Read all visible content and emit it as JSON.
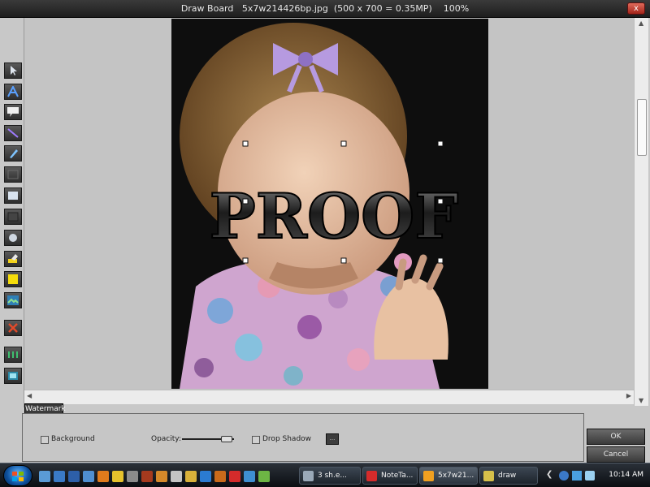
{
  "window": {
    "title": "Draw Board   5x7w214426bp.jpg  (500 x 700 = 0.35MP)    100%",
    "close_label": "x"
  },
  "toolbar": {
    "tools": [
      {
        "icon": "pointer-icon"
      },
      {
        "icon": "a-text-icon"
      },
      {
        "icon": "speech-balloon-icon"
      },
      {
        "icon": "line-icon"
      },
      {
        "icon": "pencil-icon"
      },
      {
        "icon": "rectangle-outline-icon"
      },
      {
        "icon": "rectangle-filled-icon"
      },
      {
        "icon": "dark-rectangle-icon"
      },
      {
        "icon": "ellipse-icon"
      },
      {
        "icon": "highlighter-icon"
      },
      {
        "icon": "yellow-square-icon"
      },
      {
        "icon": "image-icon"
      },
      {
        "icon": "delete-x-icon"
      },
      {
        "icon": "grid-icon"
      },
      {
        "icon": "layer-icon"
      }
    ]
  },
  "watermark": {
    "text": "PROOF",
    "tab_label": "Watermark",
    "background_label": "Background",
    "opacity_label": "Opacity:",
    "drop_shadow_label": "Drop Shadow",
    "more_button": "...",
    "background_checked": false,
    "drop_shadow_checked": false
  },
  "buttons": {
    "ok": "OK",
    "cancel": "Cancel"
  },
  "taskbar": {
    "tasks": [
      {
        "label": "3 sh.e...",
        "color": "#9aa9b8"
      },
      {
        "label": "NoteTa...",
        "color": "#d62b2b"
      },
      {
        "label": "5x7w21...",
        "color": "#f0a020"
      },
      {
        "label": "draw",
        "color": "#d6c04a"
      }
    ],
    "clock": "10:14 AM"
  },
  "colors": {
    "window_bg": "#c8c8c8",
    "title_bg": "#2a2a2a",
    "taskbar_bg": "#1a1f26"
  }
}
